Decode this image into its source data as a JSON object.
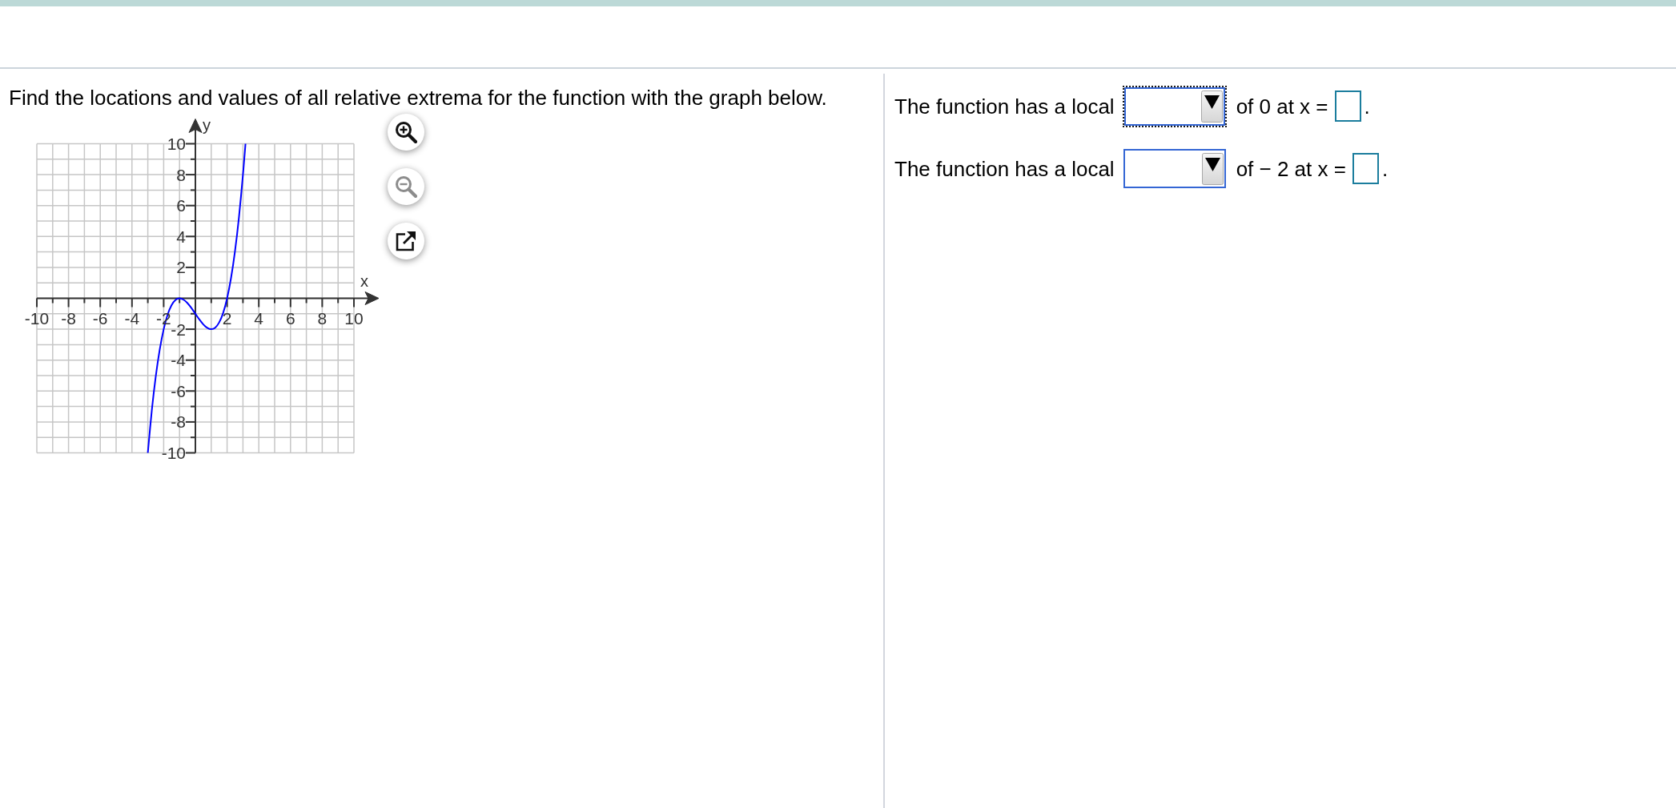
{
  "question": {
    "text": "Find the locations and values of all relative extrema for the function with the graph below.",
    "graph": {
      "chart_data": {
        "type": "line",
        "grid": true,
        "xlabel": "x",
        "ylabel": "y",
        "x": [
          -3,
          -2.75,
          -2.5,
          -2.25,
          -2,
          -1.75,
          -1.5,
          -1.25,
          -1,
          -0.75,
          -0.5,
          -0.25,
          0,
          0.25,
          0.5,
          0.75,
          1,
          1.25,
          1.5,
          1.75,
          2,
          2.25,
          2.5,
          2.75,
          3,
          3.16
        ],
        "series": [
          {
            "color": "#0000ff",
            "values": [
              -10,
              -7.27,
              -5.06,
              -3.32,
              -2,
              -1.05,
              -0.44,
              -0.1,
              0,
              -0.09,
              -0.31,
              -0.63,
              -1,
              -1.37,
              -1.69,
              -1.91,
              -2,
              -1.9,
              -1.56,
              -0.95,
              0,
              1.32,
              3.06,
              5.27,
              8,
              10
            ]
          }
        ],
        "xlim": [
          -10,
          10
        ],
        "ylim": [
          -10,
          10
        ],
        "xticks": [
          -10,
          -8,
          -6,
          -4,
          -2,
          2,
          4,
          6,
          8,
          10
        ],
        "yticks": [
          -10,
          -8,
          -6,
          -4,
          -2,
          2,
          4,
          6,
          8,
          10
        ]
      }
    },
    "graph_tools": [
      {
        "kind": "zoom_in",
        "disabled": false
      },
      {
        "kind": "zoom_out",
        "disabled": true
      },
      {
        "kind": "popout",
        "disabled": false
      }
    ]
  },
  "answers": [
    {
      "prompt": "The function has a local",
      "dropdown": {
        "focused": true
      },
      "follow": "of 0 at x =",
      "end": "."
    },
    {
      "prompt": "The function has a local",
      "dropdown": {
        "focused": false
      },
      "follow": "of − 2 at x =",
      "end": "."
    }
  ]
}
